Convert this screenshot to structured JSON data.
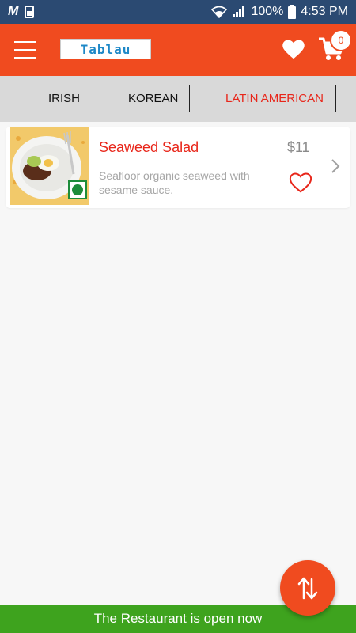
{
  "status_bar": {
    "carrier_icon": "M",
    "battery_percent": "100%",
    "time": "4:53 PM"
  },
  "app_bar": {
    "logo_text": "Tablau",
    "cart_count": "0",
    "accent_color": "#f04b1f"
  },
  "tabs": [
    {
      "label": "IRISH",
      "active": false
    },
    {
      "label": "KOREAN",
      "active": false
    },
    {
      "label": "LATIN AMERICAN",
      "active": true
    }
  ],
  "menu_items": [
    {
      "name": "Seaweed Salad",
      "description": "Seafloor organic seaweed with sesame sauce.",
      "price": "$11",
      "veg": true
    }
  ],
  "footer": {
    "status_text": "The Restaurant is open now",
    "color": "#3ea31e"
  }
}
